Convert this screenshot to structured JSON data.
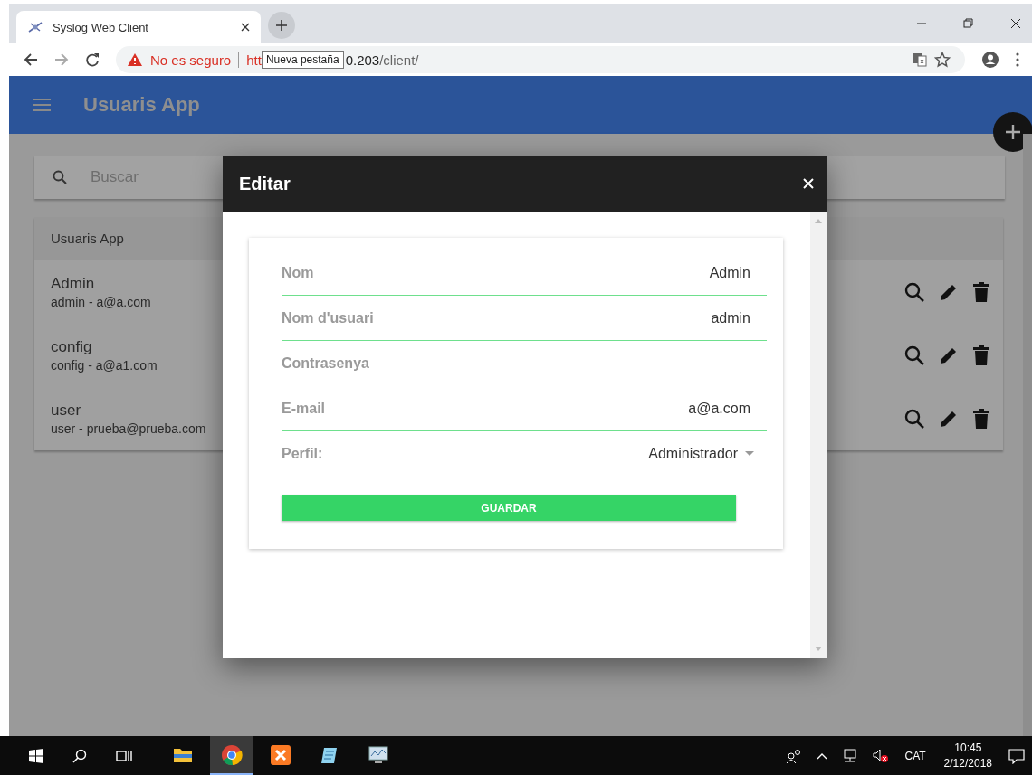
{
  "browser": {
    "tab": {
      "title": "Syslog Web Client"
    },
    "tooltip": "Nueva pestaña",
    "security": "No es seguro",
    "url_scheme": "htt",
    "url_host": "0.203",
    "url_path": "/client/"
  },
  "app_bar": {
    "title": "Usuaris App"
  },
  "search": {
    "placeholder": "Buscar"
  },
  "user_list": {
    "header": "Usuaris App",
    "users": [
      {
        "name": "Admin",
        "detail": "admin - a@a.com"
      },
      {
        "name": "config",
        "detail": "config - a@a1.com"
      },
      {
        "name": "user",
        "detail": "user - prueba@prueba.com"
      }
    ]
  },
  "dialog": {
    "title": "Editar",
    "fields": [
      {
        "kind": "text",
        "label": "Nom",
        "value": "Admin"
      },
      {
        "kind": "text",
        "label": "Nom d'usuari",
        "value": "admin"
      },
      {
        "kind": "password",
        "label": "Contrasenya"
      },
      {
        "kind": "text",
        "label": "E-mail",
        "value": "a@a.com"
      },
      {
        "kind": "select",
        "label": "Perfil:",
        "value": "Administrador"
      }
    ],
    "button": "GUARDAR"
  },
  "taskbar": {
    "apps": [
      {
        "kind": "explorer",
        "selected": false
      },
      {
        "kind": "chrome",
        "selected": true
      },
      {
        "kind": "xampp",
        "selected": false
      },
      {
        "kind": "notepad",
        "selected": false
      },
      {
        "kind": "monitor",
        "selected": false
      }
    ],
    "language": "CAT",
    "time": "10:45",
    "date": "2/12/2018"
  }
}
